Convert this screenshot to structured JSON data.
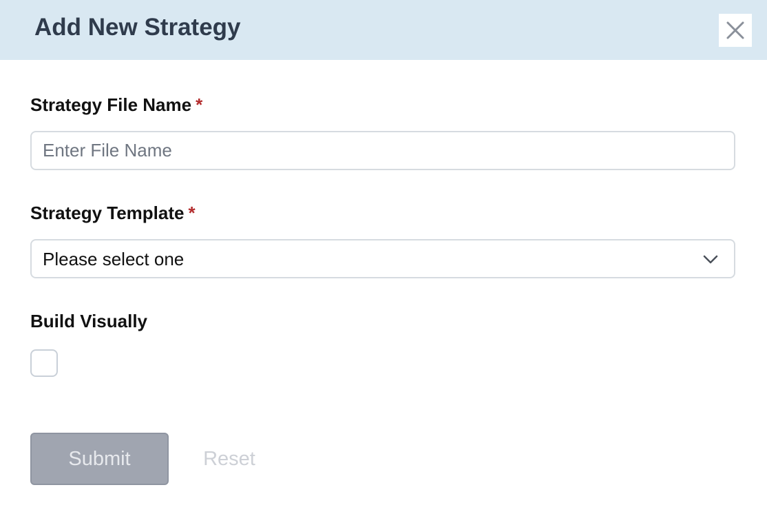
{
  "modal": {
    "title": "Add New Strategy",
    "close_icon": "close-icon"
  },
  "form": {
    "file_name": {
      "label": "Strategy File Name",
      "required_mark": "*",
      "placeholder": "Enter File Name",
      "value": ""
    },
    "template": {
      "label": "Strategy Template",
      "required_mark": "*",
      "selected": "Please select one",
      "dropdown_icon": "chevron-down-icon"
    },
    "build_visually": {
      "label": "Build Visually",
      "checked": false
    }
  },
  "actions": {
    "submit_label": "Submit",
    "reset_label": "Reset"
  },
  "colors": {
    "header_bg": "#d9e8f2",
    "title_text": "#2f3b4c",
    "required": "#b32d2e",
    "submit_bg_disabled": "#a0a5b0",
    "reset_text_disabled": "#cdd0d6"
  }
}
